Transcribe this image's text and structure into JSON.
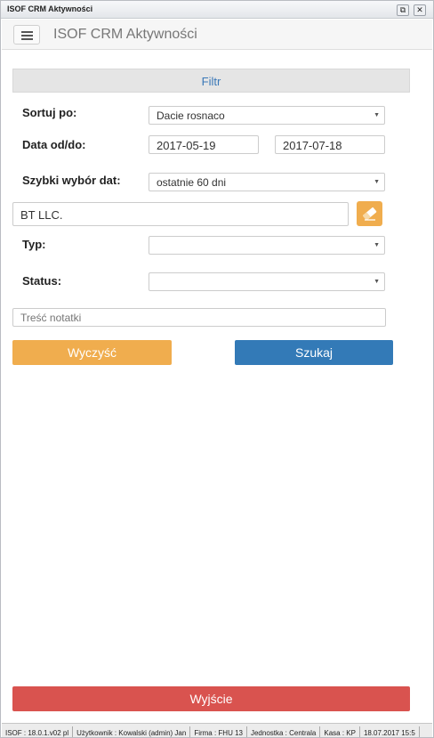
{
  "window": {
    "title": "ISOF CRM Aktywności"
  },
  "appbar": {
    "title": "ISOF CRM Aktywności"
  },
  "filter": {
    "header": "Filtr",
    "sort_label": "Sortuj po:",
    "sort_value": "Dacie rosnaco",
    "date_label": "Data od/do:",
    "date_from": "2017-05-19",
    "date_to": "2017-07-18",
    "quick_label": "Szybki wybór dat:",
    "quick_value": "ostatnie 60 dni",
    "client_value": "BT LLC.",
    "type_label": "Typ:",
    "type_value": "",
    "status_label": "Status:",
    "status_value": "",
    "note_placeholder": "Treść notatki"
  },
  "buttons": {
    "clear": "Wyczyść",
    "search": "Szukaj",
    "exit": "Wyjście"
  },
  "statusbar": {
    "items": [
      "ISOF : 18.0.1.v02 pl",
      "Użytkownik : Kowalski (admin) Jan",
      "Firma : FHU 13",
      "Jednostka : Centrala",
      "Kasa : KP",
      "18.07.2017 15:5"
    ]
  }
}
